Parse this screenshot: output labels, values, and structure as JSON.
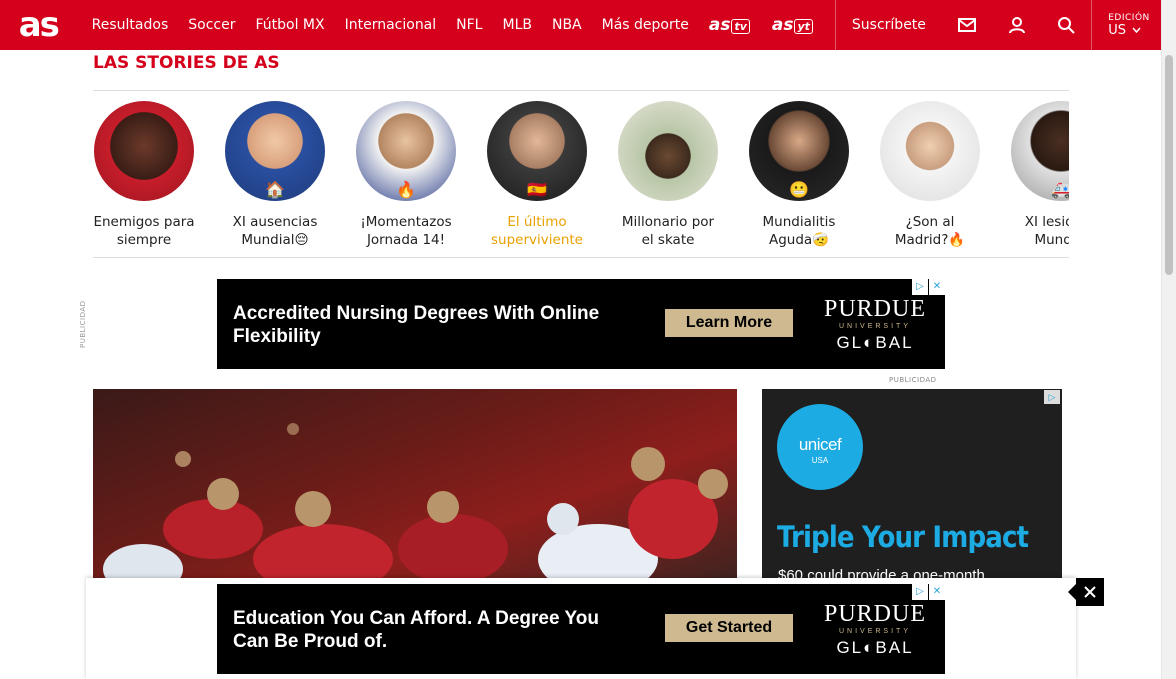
{
  "nav": {
    "logo": "as",
    "items": [
      "Resultados",
      "Soccer",
      "Fútbol MX",
      "Internacional",
      "NFL",
      "MLB",
      "NBA",
      "Más deporte"
    ],
    "brand_tv": "as",
    "brand_tv_badge": "tv",
    "brand_yt": "as",
    "brand_yt_badge": "yt",
    "subscribe": "Suscríbete",
    "edition_label": "EDICIÓN",
    "edition_value": "US"
  },
  "stories": {
    "title": "LAS STORIES DE AS",
    "items": [
      {
        "label": "Enemigos para siempre",
        "emoji": ""
      },
      {
        "label": "XI ausencias Mundial😔",
        "emoji": "🏠"
      },
      {
        "label": "¡Momentazos Jornada 14!",
        "emoji": "🔥"
      },
      {
        "label": "El último superviviente",
        "emoji": "🇪🇸"
      },
      {
        "label": "Millonario por el skate",
        "emoji": ""
      },
      {
        "label": "Mundialitis Aguda🤕",
        "emoji": "😬"
      },
      {
        "label": "¿Son al Madrid?🔥",
        "emoji": ""
      },
      {
        "label": "XI lesiones Mundial",
        "emoji": "🚑"
      }
    ]
  },
  "ad_top": {
    "label": "PUBLICIDAD",
    "headline": "Accredited Nursing Degrees With Online Flexibility",
    "cta": "Learn More",
    "brand_1": "PURDUE",
    "brand_2": "UNIVERSITY",
    "brand_3": "GL◐BAL"
  },
  "ad_side": {
    "label": "PUBLICIDAD",
    "brand": "unicef",
    "brand_sub": "USA",
    "tagline": "Triple Your Impact",
    "sub": "$60 could provide a one-month"
  },
  "ad_sticky": {
    "headline": "Education You Can Afford. A Degree You Can Be Proud of.",
    "cta": "Get Started",
    "brand_1": "PURDUE",
    "brand_2": "UNIVERSITY",
    "brand_3": "GL◐BAL"
  },
  "colors": {
    "brand_red": "#d5001c",
    "highlight": "#e9a100",
    "purdue_gold": "#cfb991",
    "unicef_blue": "#1cabe2"
  }
}
